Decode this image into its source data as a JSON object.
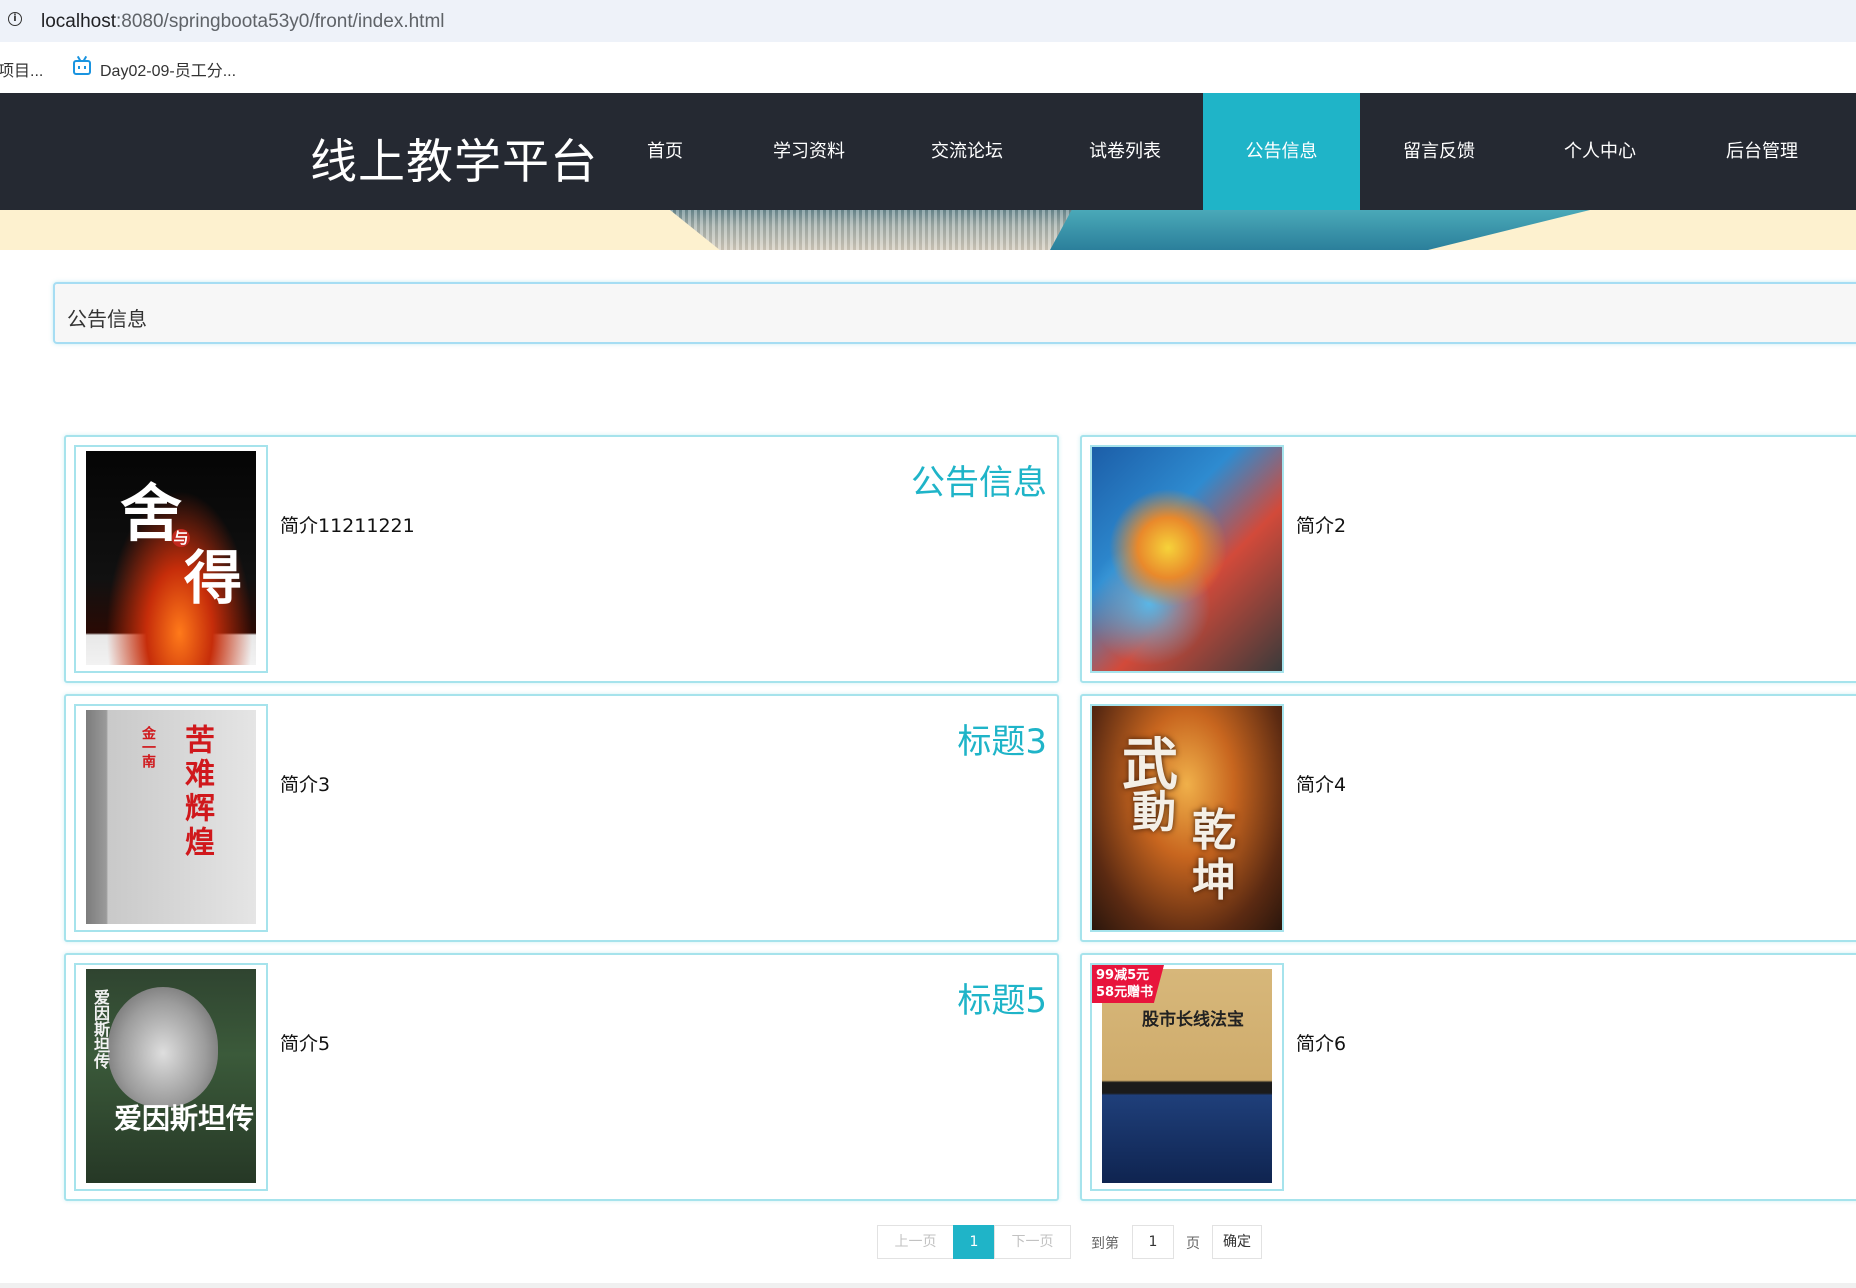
{
  "browser": {
    "url_host": "localhost",
    "url_path": ":8080/springboota53y0/front/index.html",
    "bookmarks": [
      {
        "label": "项目..."
      },
      {
        "label": "Day02-09-员工分..."
      }
    ]
  },
  "site": {
    "title": "线上教学平台",
    "nav": [
      {
        "label": "首页",
        "active": false
      },
      {
        "label": "学习资料",
        "active": false
      },
      {
        "label": "交流论坛",
        "active": false
      },
      {
        "label": "试卷列表",
        "active": false
      },
      {
        "label": "公告信息",
        "active": true
      },
      {
        "label": "留言反馈",
        "active": false
      },
      {
        "label": "个人中心",
        "active": false
      },
      {
        "label": "后台管理",
        "active": false
      }
    ]
  },
  "section": {
    "title": "公告信息"
  },
  "cards": [
    {
      "title": "公告信息",
      "intro": "简介11211221",
      "cover_text": [
        "舍",
        "与",
        "得"
      ]
    },
    {
      "title": "",
      "intro": "简介2",
      "cover_text": []
    },
    {
      "title": "标题3",
      "intro": "简介3",
      "cover_text": [
        "苦难辉煌",
        "金一南"
      ]
    },
    {
      "title": "",
      "intro": "简介4",
      "cover_text": [
        "武",
        "動",
        "乾",
        "坤"
      ]
    },
    {
      "title": "标题5",
      "intro": "简介5",
      "cover_text": [
        "爱因斯坦传",
        "爱因斯坦传"
      ]
    },
    {
      "title": "",
      "intro": "简介6",
      "cover_text": [
        "股市长线法宝",
        "99减5元",
        "58元赠书"
      ]
    }
  ],
  "pagination": {
    "prev": "上一页",
    "current": "1",
    "next": "下一页",
    "goto_prefix": "到第",
    "page_input": "1",
    "goto_suffix": "页",
    "confirm": "确定"
  }
}
